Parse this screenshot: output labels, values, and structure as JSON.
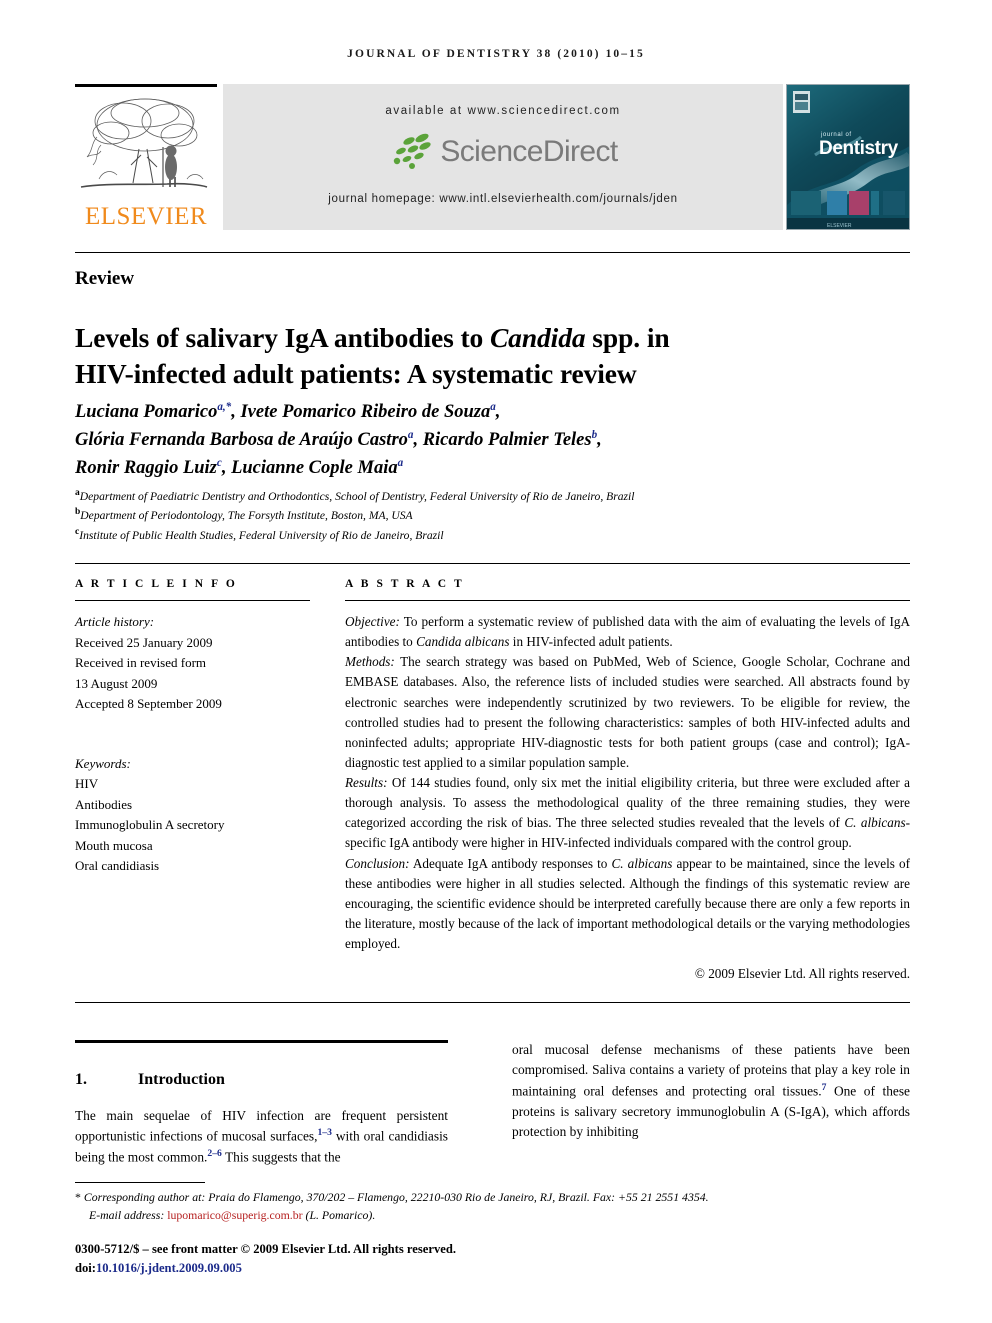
{
  "running_head": "JOURNAL OF DENTISTRY 38 (2010) 10–15",
  "masthead": {
    "publisher_name": "ELSEVIER",
    "publisher_logo_alt": "elsevier-tree-logo",
    "available_at": "available at www.sciencedirect.com",
    "sciencedirect_wordmark": "ScienceDirect",
    "journal_homepage": "journal homepage: www.intl.elsevierhealth.com/journals/jden",
    "cover_title_small": "journal of",
    "cover_title_main": "Dentistry",
    "colors": {
      "elsevier_orange": "#f08a1c",
      "sciencedirect_green": "#5ba33a",
      "sciencedirect_grey": "#7a7a7a",
      "banner_grey": "#e4e4e4",
      "cover_teal": "#14515f"
    }
  },
  "article": {
    "section_type": "Review",
    "title_line1_a": "Levels of salivary IgA antibodies to ",
    "title_line1_italic": "Candida",
    "title_line1_b": " spp. in",
    "title_line2": "HIV-infected adult patients: A systematic review",
    "authors_line1": "Luciana Pomarico",
    "authors_line1_sup": "a,*",
    "authors_line1_b": ", Ivete Pomarico Ribeiro de Souza",
    "authors_line1_sup2": "a",
    "authors_line1_c": ",",
    "authors_line2": "Glória Fernanda Barbosa de Araújo Castro",
    "authors_line2_sup": "a",
    "authors_line2_b": ", Ricardo Palmier Teles",
    "authors_line2_sup2": "b",
    "authors_line2_c": ",",
    "authors_line3": "Ronir Raggio Luiz",
    "authors_line3_sup": "c",
    "authors_line3_b": ", Lucianne Cople Maia",
    "authors_line3_sup2": "a",
    "affiliations": [
      {
        "marker": "a",
        "text": "Department of Paediatric Dentistry and Orthodontics, School of Dentistry, Federal University of Rio de Janeiro, Brazil"
      },
      {
        "marker": "b",
        "text": "Department of Periodontology, The Forsyth Institute, Boston, MA, USA"
      },
      {
        "marker": "c",
        "text": "Institute of Public Health Studies, Federal University of Rio de Janeiro, Brazil"
      }
    ]
  },
  "article_info": {
    "heading": "A R T I C L E   I N F O",
    "history_label": "Article history:",
    "history": [
      "Received 25 January 2009",
      "Received in revised form",
      "13 August 2009",
      "Accepted 8 September 2009"
    ],
    "keywords_label": "Keywords:",
    "keywords": [
      "HIV",
      "Antibodies",
      "Immunoglobulin A secretory",
      "Mouth mucosa",
      "Oral candidiasis"
    ]
  },
  "abstract": {
    "heading": "A B S T R A C T",
    "objective_label": "Objective:",
    "objective_a": " To perform a systematic review of published data with the aim of evaluating the levels of IgA antibodies to ",
    "objective_italic": "Candida albicans",
    "objective_b": " in HIV-infected adult patients.",
    "methods_label": "Methods:",
    "methods_text": " The search strategy was based on PubMed, Web of Science, Google Scholar, Cochrane and EMBASE databases. Also, the reference lists of included studies were searched. All abstracts found by electronic searches were independently scrutinized by two reviewers. To be eligible for review, the controlled studies had to present the following characteristics: samples of both HIV-infected adults and noninfected adults; appropriate HIV-diagnostic tests for both patient groups (case and control); IgA-diagnostic test applied to a similar population sample.",
    "results_label": "Results:",
    "results_a": " Of 144 studies found, only six met the initial eligibility criteria, but three were excluded after a thorough analysis. To assess the methodological quality of the three remaining studies, they were categorized according the risk of bias. The three selected studies revealed that the levels of ",
    "results_italic": "C. albicans",
    "results_b": "-specific IgA antibody were higher in HIV-infected individuals compared with the control group.",
    "conclusion_label": "Conclusion:",
    "conclusion_a": " Adequate IgA antibody responses to ",
    "conclusion_italic": "C. albicans",
    "conclusion_b": " appear to be maintained, since the levels of these antibodies were higher in all studies selected. Although the findings of this systematic review are encouraging, the scientific evidence should be interpreted carefully because there are only a few reports in the literature, mostly because of the lack of important methodological details or the varying methodologies employed.",
    "copyright": "© 2009 Elsevier Ltd. All rights reserved."
  },
  "body": {
    "section_number": "1.",
    "section_title": "Introduction",
    "left_text_a": "The main sequelae of HIV infection are frequent persistent opportunistic infections of mucosal surfaces,",
    "left_cite_1": "1–3",
    "left_text_b": " with oral candidiasis being the most common.",
    "left_cite_2": "2–6",
    "left_text_c": " This suggests that the",
    "right_text_a": "oral mucosal defense mechanisms of these patients have been compromised. Saliva contains a variety of proteins that play a key role in maintaining oral defenses and protecting oral tissues.",
    "right_cite_1": "7",
    "right_text_b": " One of these proteins is salivary secretory immunoglobulin A (S-IgA), which affords protection by inhibiting"
  },
  "footer": {
    "star": "*",
    "corresponding_author": " Corresponding author at: Praia do Flamengo, 370/202 – Flamengo, 22210-030 Rio de Janeiro, RJ, Brazil. Fax: +55 21 2551 4354.",
    "email_label": "E-mail address: ",
    "email": "lupomarico@superig.com.br",
    "email_suffix": " (L. Pomarico).",
    "issn_line": "0300-5712/$ – see front matter © 2009 Elsevier Ltd. All rights reserved.",
    "doi_label": "doi:",
    "doi": "10.1016/j.jdent.2009.09.005"
  }
}
